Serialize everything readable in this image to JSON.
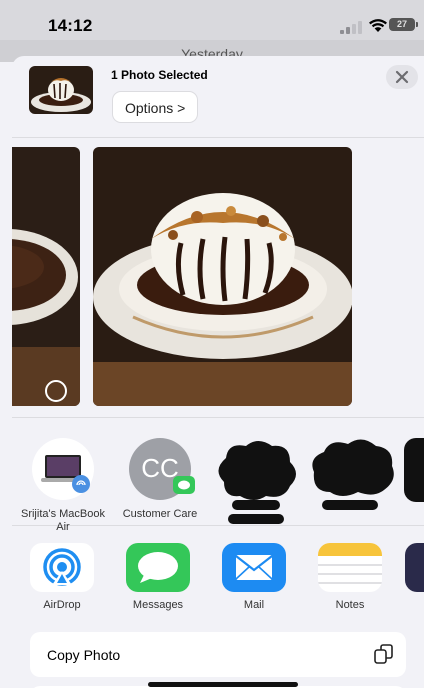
{
  "status_bar": {
    "time": "14:12",
    "battery_level": "27",
    "signal_icon": "signal-bars-icon",
    "wifi_icon": "wifi-icon"
  },
  "underlay": {
    "title": "Yesterday"
  },
  "header": {
    "selection_label": "1 Photo Selected",
    "options_label": "Options >",
    "close_icon": "close-icon"
  },
  "photos": {
    "items": [
      {
        "selected": false
      },
      {
        "selected": true
      }
    ]
  },
  "people": [
    {
      "label": "Srijita's MacBook Air",
      "icon": "macbook-icon"
    },
    {
      "label": "Customer Care",
      "initials": "CC",
      "badge_icon": "messages-badge-icon"
    },
    {
      "label": "",
      "note": "redacted"
    },
    {
      "label": "",
      "note": "redacted"
    }
  ],
  "apps": [
    {
      "label": "AirDrop",
      "icon": "airdrop-icon"
    },
    {
      "label": "Messages",
      "icon": "messages-icon"
    },
    {
      "label": "Mail",
      "icon": "mail-icon"
    },
    {
      "label": "Notes",
      "icon": "notes-icon"
    }
  ],
  "actions": [
    {
      "label": "Copy Photo",
      "icon": "copy-icon"
    }
  ],
  "colors": {
    "accent": "#2f7df6",
    "messages_green": "#34c759",
    "mail_blue": "#1d8bf2",
    "notes_yellow": "#f7c43b",
    "sheet_background": "#f2f2f7"
  }
}
